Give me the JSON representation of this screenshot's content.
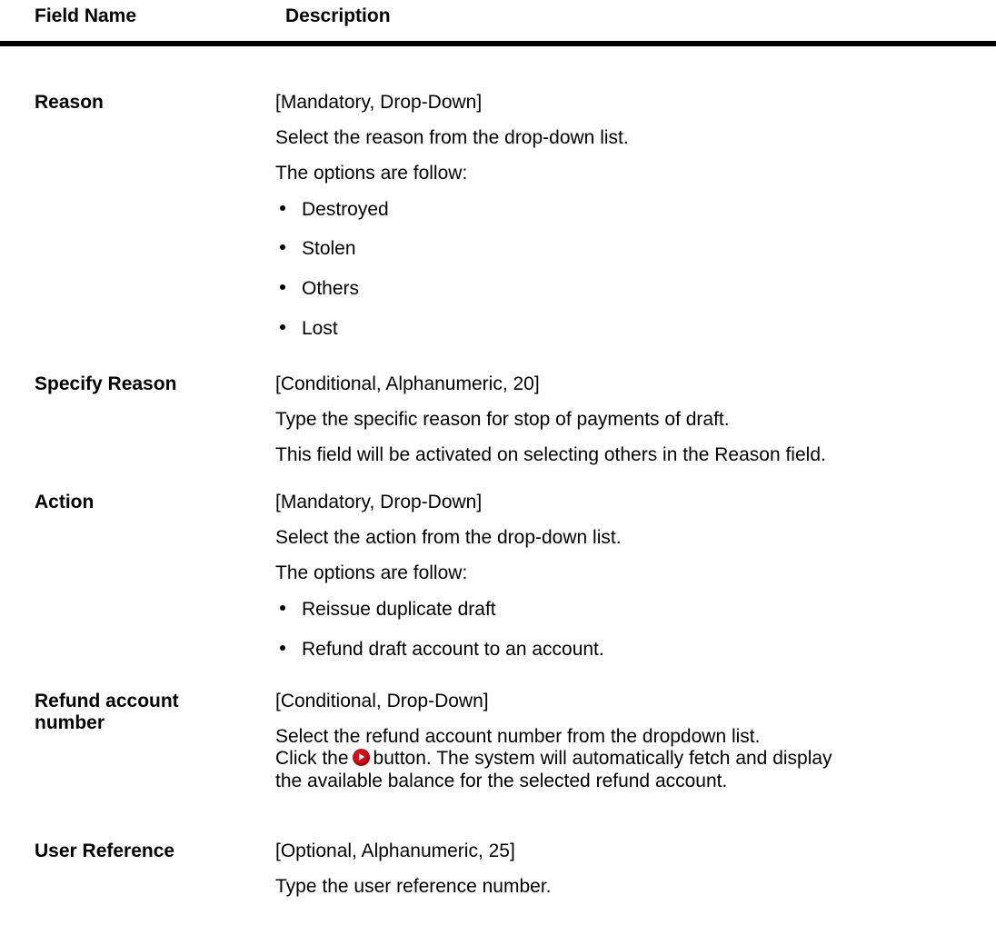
{
  "table": {
    "header": {
      "field_name": "Field Name",
      "description": "Description"
    },
    "rows": [
      {
        "field": "Reason",
        "lines": [
          "[Mandatory, Drop-Down]",
          "Select the reason from the drop-down list.",
          "The options are follow:"
        ],
        "bullets": [
          "Destroyed",
          "Stolen",
          "Others",
          "Lost"
        ]
      },
      {
        "field": "Specify Reason",
        "lines": [
          "[Conditional, Alphanumeric, 20]",
          "Type the specific reason for stop of payments of draft.",
          "This field will be activated on selecting others in the Reason field."
        ]
      },
      {
        "field": "Action",
        "lines": [
          "[Mandatory, Drop-Down]",
          "Select the action from the drop-down list.",
          "The options are follow:"
        ],
        "bullets": [
          "Reissue duplicate draft",
          "Refund draft account to an account."
        ]
      },
      {
        "field_lines": [
          "Refund account",
          "number"
        ],
        "lines": [
          "[Conditional, Drop-Down]",
          "Select the refund account number from the dropdown list.",
          "Click the",
          "button. The system will automatically fetch and display",
          "the available balance for the selected refund account."
        ],
        "icon": "red-arrow-button-icon"
      },
      {
        "field": "User Reference",
        "lines": [
          "[Optional, Alphanumeric, 25]",
          "Type the user reference number."
        ]
      }
    ]
  }
}
